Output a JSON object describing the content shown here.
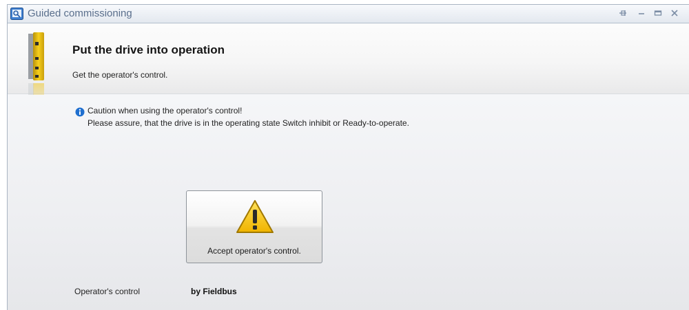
{
  "window": {
    "title": "Guided commissioning",
    "icons": {
      "app": "wizard-icon",
      "pin": "pin-icon",
      "minimize": "minimize-icon",
      "maximize": "maximize-icon",
      "close": "close-icon"
    }
  },
  "header": {
    "title": "Put the drive into operation",
    "subtitle": "Get the operator's control.",
    "icon": "servo-drive-icon"
  },
  "notice": {
    "icon": "info-icon",
    "line1": "Caution when using the operator's control!",
    "line2": "Please assure, that the drive is in the operating state Switch inhibit or Ready-to-operate."
  },
  "accept_button": {
    "icon": "warning-icon",
    "label": "Accept operator's control."
  },
  "operator_control": {
    "label": "Operator's control",
    "value": "by Fieldbus"
  },
  "colors": {
    "title_text": "#5a6f8c",
    "drive_yellow": "#f2c300",
    "info_blue": "#1f6fcf",
    "warning_yellow": "#f5c400"
  }
}
